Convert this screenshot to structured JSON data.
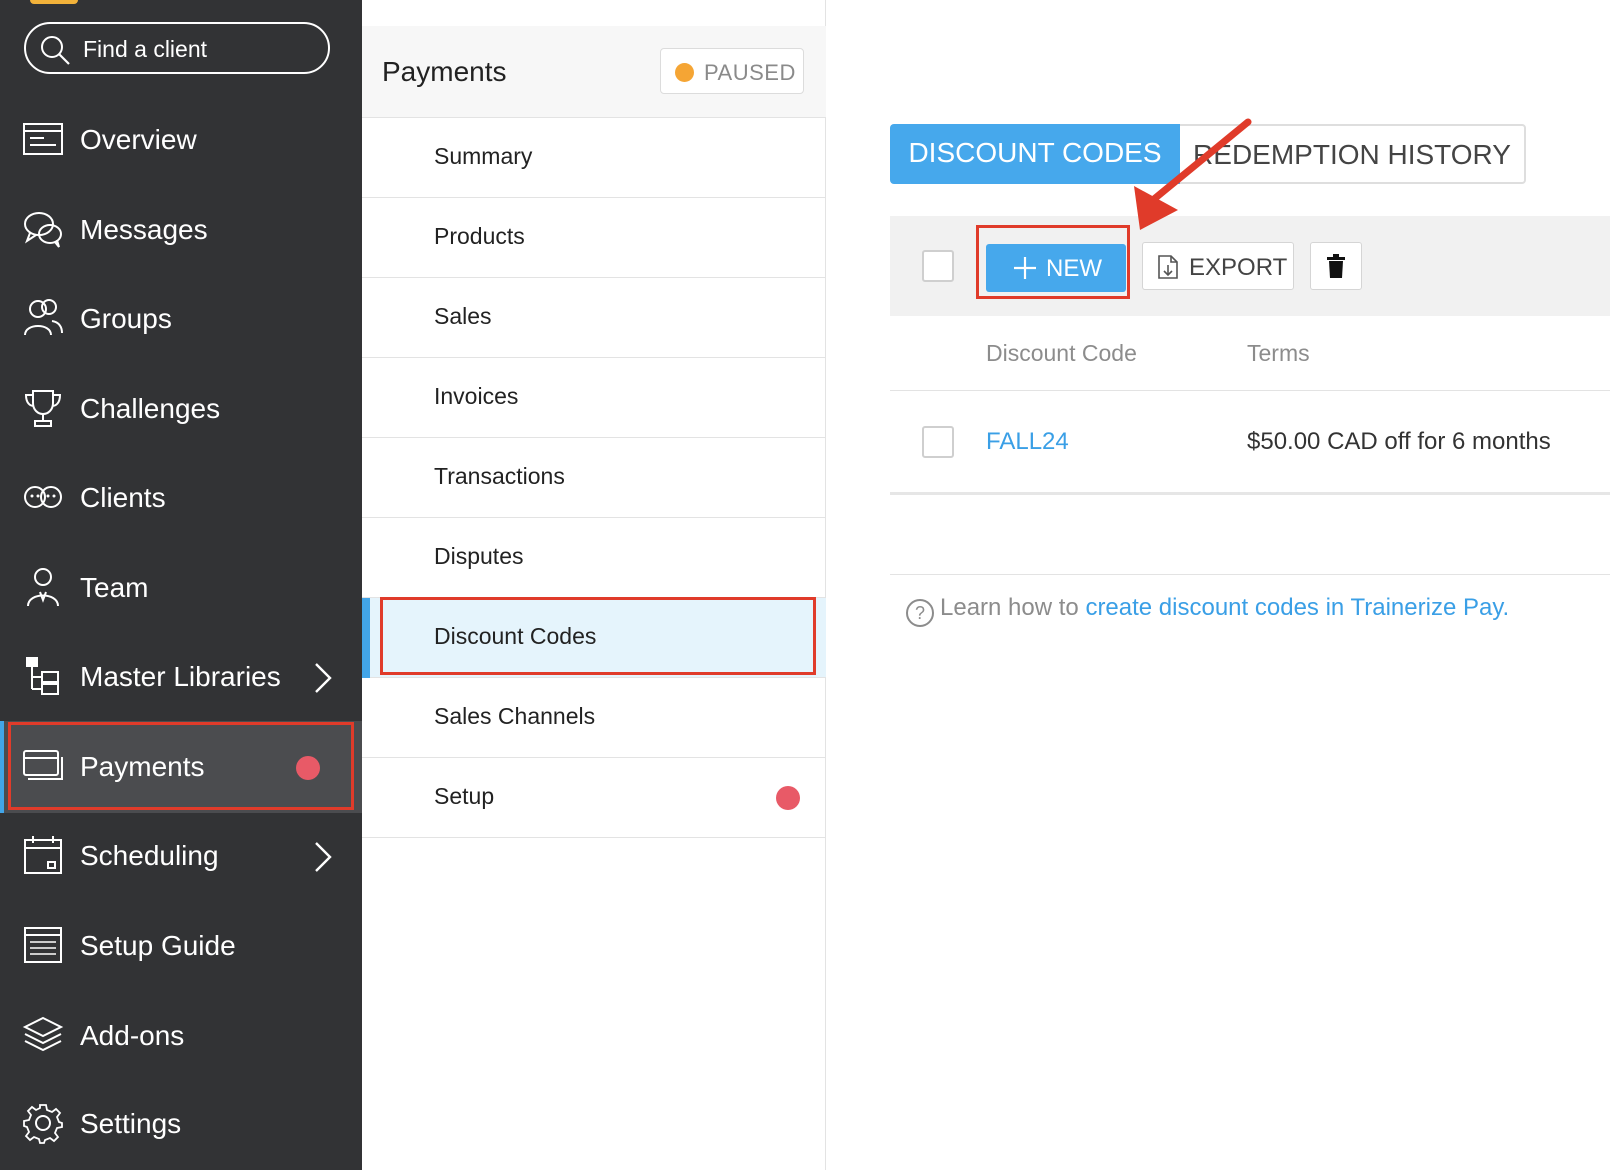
{
  "sidebar": {
    "search_placeholder": "Find a client",
    "items": [
      {
        "label": "Overview",
        "icon": "overview-icon"
      },
      {
        "label": "Messages",
        "icon": "messages-icon"
      },
      {
        "label": "Groups",
        "icon": "groups-icon"
      },
      {
        "label": "Challenges",
        "icon": "trophy-icon"
      },
      {
        "label": "Clients",
        "icon": "clients-icon"
      },
      {
        "label": "Team",
        "icon": "team-icon"
      },
      {
        "label": "Master Libraries",
        "icon": "libraries-icon",
        "has_submenu": true
      },
      {
        "label": "Payments",
        "icon": "credit-card-icon",
        "active": true,
        "has_alert": true
      },
      {
        "label": "Scheduling",
        "icon": "calendar-icon",
        "has_submenu": true
      },
      {
        "label": "Setup Guide",
        "icon": "setup-guide-icon"
      },
      {
        "label": "Add-ons",
        "icon": "add-ons-icon"
      },
      {
        "label": "Settings",
        "icon": "gear-icon"
      }
    ]
  },
  "subnav": {
    "title": "Payments",
    "status": "PAUSED",
    "items": [
      {
        "label": "Summary"
      },
      {
        "label": "Products"
      },
      {
        "label": "Sales"
      },
      {
        "label": "Invoices"
      },
      {
        "label": "Transactions"
      },
      {
        "label": "Disputes"
      },
      {
        "label": "Discount Codes",
        "active": true
      },
      {
        "label": "Sales Channels"
      },
      {
        "label": "Setup",
        "has_alert": true
      }
    ]
  },
  "main": {
    "tabs": [
      {
        "label": "DISCOUNT CODES",
        "active": true
      },
      {
        "label": "REDEMPTION HISTORY"
      }
    ],
    "toolbar": {
      "new_label": "NEW",
      "export_label": "EXPORT"
    },
    "table": {
      "columns": [
        "Discount Code",
        "Terms"
      ],
      "rows": [
        {
          "code": "FALL24",
          "terms": "$50.00 CAD off for 6 months"
        }
      ]
    },
    "help": {
      "prefix": "Learn how to ",
      "link": "create discount codes in Trainerize Pay."
    }
  },
  "colors": {
    "sidebar_bg": "#323335",
    "accent_blue": "#46a8ec",
    "alert_red": "#e85a67",
    "paused_orange": "#f5a534",
    "annotation_red": "#e03b2a"
  }
}
